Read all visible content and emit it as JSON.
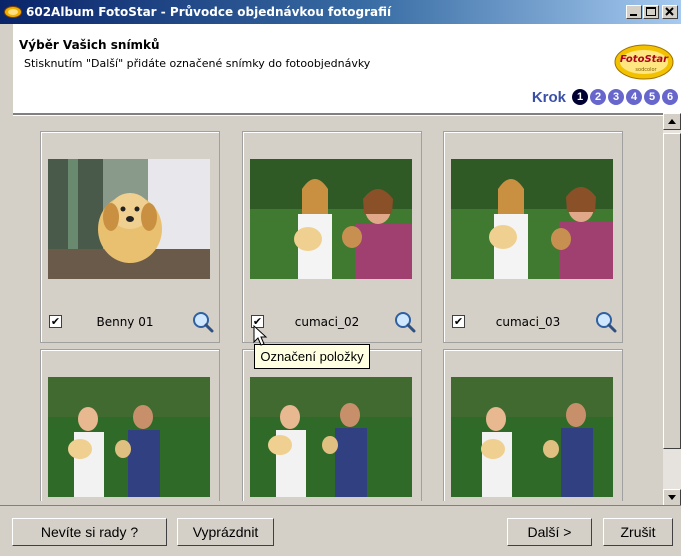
{
  "window": {
    "title": "602Album FotoStar - Průvodce objednávkou fotografií"
  },
  "header": {
    "title": "Výběr Vašich snímků",
    "subtitle": "Stisknutím \"Další\" přidáte označené snímky do fotoobjednávky",
    "logo_text": "FotoStar",
    "logo_sub": "sodcolor"
  },
  "steps": {
    "label": "Krok",
    "items": [
      "1",
      "2",
      "3",
      "4",
      "5",
      "6"
    ],
    "active": 1
  },
  "photos": [
    {
      "name": "Benny 01",
      "checked": true
    },
    {
      "name": "cumaci_02",
      "checked": true
    },
    {
      "name": "cumaci_03",
      "checked": true
    },
    {
      "name": "",
      "checked": false
    },
    {
      "name": "",
      "checked": false
    },
    {
      "name": "",
      "checked": false
    }
  ],
  "tooltip": "Označení položky",
  "buttons": {
    "help": "Nevíte si rady ?",
    "clear": "Vyprázdnit",
    "next": "Další >",
    "cancel": "Zrušit"
  }
}
